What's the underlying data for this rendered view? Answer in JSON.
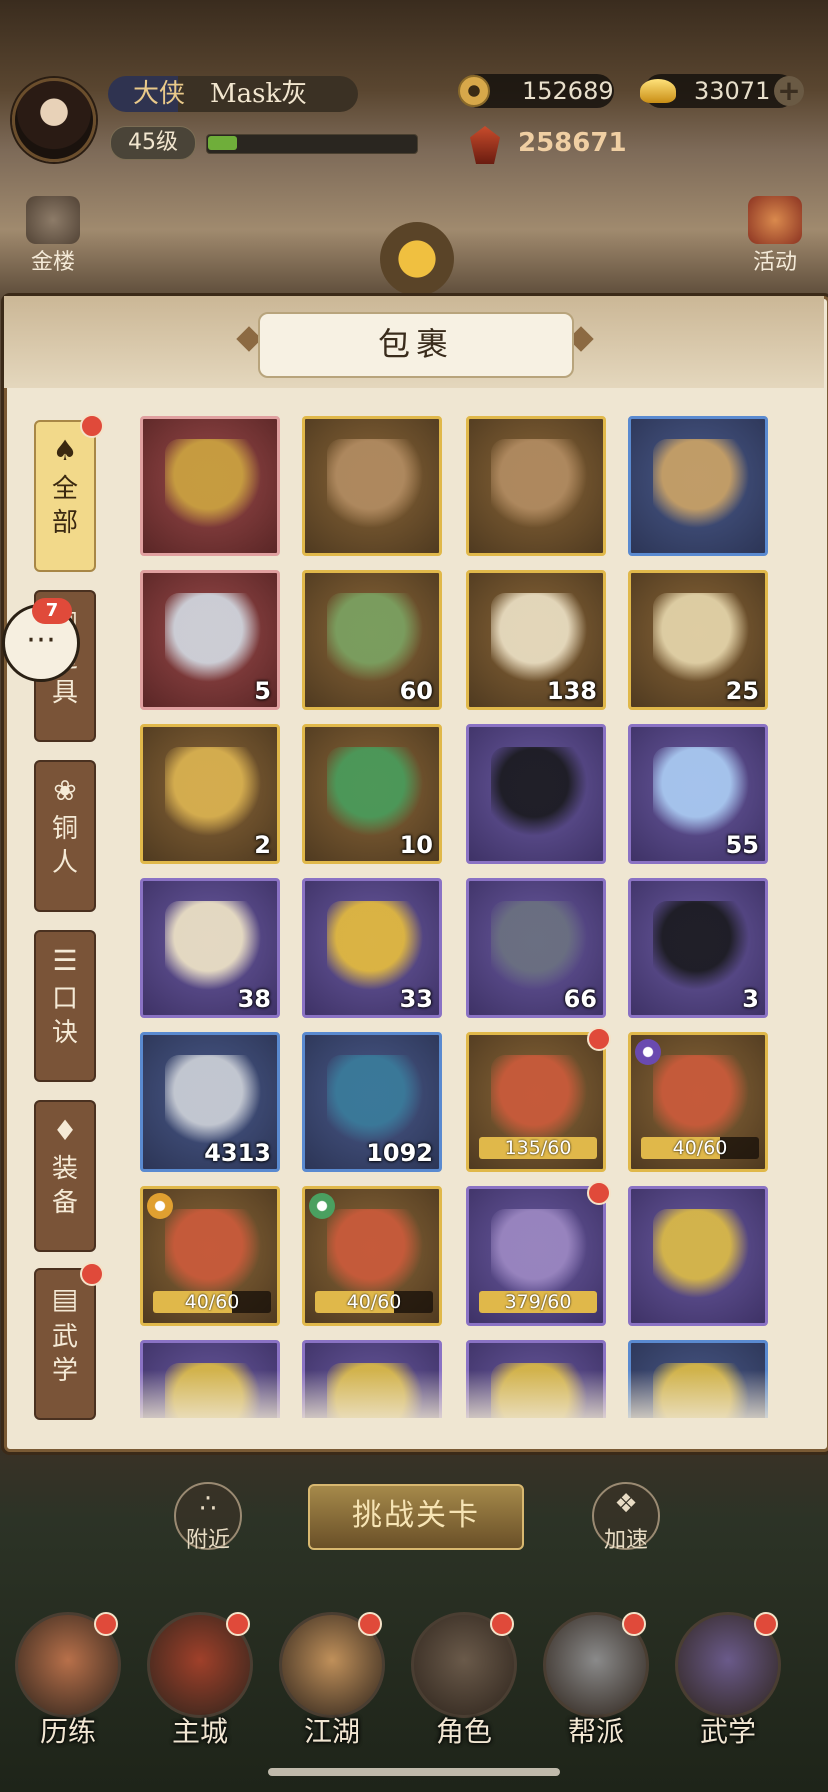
{
  "player": {
    "title": "大侠",
    "name": "Mask灰",
    "level": "45级",
    "exp_fraction": 0.14,
    "copper": "152689",
    "ingot": "33071",
    "power": "258671"
  },
  "side_buttons": {
    "left": "金楼",
    "right": "活动"
  },
  "panel": {
    "title": "包裹"
  },
  "tabs": [
    {
      "label_a": "全",
      "label_b": "部",
      "icon": "fan-icon",
      "active": true,
      "dot": true
    },
    {
      "label_a": "道",
      "label_b": "具",
      "icon": "box-icon",
      "active": false,
      "dot": false
    },
    {
      "label_a": "铜",
      "label_b": "人",
      "icon": "figure-icon",
      "active": false,
      "dot": false
    },
    {
      "label_a": "口",
      "label_b": "诀",
      "icon": "scroll-icon",
      "active": false,
      "dot": false
    },
    {
      "label_a": "装",
      "label_b": "备",
      "icon": "armor-icon",
      "active": false,
      "dot": false
    },
    {
      "label_a": "武",
      "label_b": "学",
      "icon": "book-icon",
      "active": false,
      "dot": true
    }
  ],
  "chat": {
    "badge": "7",
    "icon": "chat-bubble-icon"
  },
  "items": [
    {
      "name": "golden-chest-item",
      "rarity": "red",
      "qty": "",
      "art": "#c9a040"
    },
    {
      "name": "card-chest-item",
      "rarity": "gold",
      "qty": "",
      "art": "#b08a60"
    },
    {
      "name": "card-chest-item",
      "rarity": "gold",
      "qty": "",
      "art": "#b08a60"
    },
    {
      "name": "weapon-chest-item",
      "rarity": "blue",
      "qty": "",
      "art": "#c7a066"
    },
    {
      "name": "rouge-bowl-item",
      "rarity": "red",
      "qty": "5",
      "art": "#cfd4dc"
    },
    {
      "name": "rainbow-flower-item",
      "rarity": "gold",
      "qty": "60",
      "art": "#7aa060"
    },
    {
      "name": "qianji-envelope-item",
      "rarity": "gold",
      "qty": "138",
      "art": "#e8dcc0"
    },
    {
      "name": "qianji-envelope-item",
      "rarity": "gold",
      "qty": "25",
      "art": "#e2d2a8"
    },
    {
      "name": "qianji-book-item",
      "rarity": "gold",
      "qty": "2",
      "art": "#d8b050"
    },
    {
      "name": "speed-token-item",
      "rarity": "gold",
      "qty": "10",
      "art": "#4a9a5a"
    },
    {
      "name": "black-stone-item",
      "rarity": "purple",
      "qty": "",
      "art": "#1c1c22"
    },
    {
      "name": "crystal-item",
      "rarity": "purple",
      "qty": "55",
      "art": "#a8c8f0"
    },
    {
      "name": "arena-scroll-item",
      "rarity": "purple",
      "qty": "38",
      "art": "#eadfc4"
    },
    {
      "name": "gold-star-item",
      "rarity": "purple",
      "qty": "33",
      "art": "#e0b840"
    },
    {
      "name": "iron-ore-item",
      "rarity": "purple",
      "qty": "66",
      "art": "#6a7080"
    },
    {
      "name": "black-stone-item",
      "rarity": "purple",
      "qty": "3",
      "art": "#1c1c22"
    },
    {
      "name": "scroll-item",
      "rarity": "blue",
      "qty": "4313",
      "art": "#c8ccd4"
    },
    {
      "name": "taiji-coin-item",
      "rarity": "blue",
      "qty": "1092",
      "art": "#3a7a9a"
    },
    {
      "name": "martial-manual-item",
      "rarity": "gold",
      "progress": "135/60",
      "pfrac": 1,
      "dot": true,
      "art": "#c85a3a"
    },
    {
      "name": "martial-manual-item",
      "rarity": "gold",
      "progress": "40/60",
      "pfrac": 0.667,
      "elem": "#6a4ab0",
      "art": "#c85a3a"
    },
    {
      "name": "martial-manual-item",
      "rarity": "gold",
      "progress": "40/60",
      "pfrac": 0.667,
      "elem": "#e0a030",
      "art": "#c85a3a"
    },
    {
      "name": "martial-manual-item",
      "rarity": "gold",
      "progress": "40/60",
      "pfrac": 0.667,
      "elem": "#4aa060",
      "art": "#c85a3a"
    },
    {
      "name": "martial-manual-item",
      "rarity": "purple",
      "progress": "379/60",
      "pfrac": 1,
      "dot": true,
      "art": "#9a86c0"
    },
    {
      "name": "skill-card-item",
      "rarity": "purple",
      "qty": "",
      "art": "#d8b848"
    },
    {
      "name": "skill-card-item",
      "rarity": "purple",
      "qty": "",
      "art": "#d8b848"
    },
    {
      "name": "skill-card-item",
      "rarity": "purple",
      "qty": "",
      "art": "#d8b848"
    },
    {
      "name": "skill-card-item",
      "rarity": "purple",
      "qty": "",
      "art": "#d8b848"
    },
    {
      "name": "skill-card-item",
      "rarity": "blue",
      "qty": "",
      "art": "#d8b848"
    }
  ],
  "bottom": {
    "challenge": "挑战关卡",
    "nearby": "附近",
    "speedup": "加速"
  },
  "nav": [
    {
      "label": "历练",
      "dot": true
    },
    {
      "label": "主城",
      "dot": true
    },
    {
      "label": "江湖",
      "dot": true
    },
    {
      "label": "角色",
      "dot": true
    },
    {
      "label": "帮派",
      "dot": true
    },
    {
      "label": "武学",
      "dot": true
    }
  ]
}
